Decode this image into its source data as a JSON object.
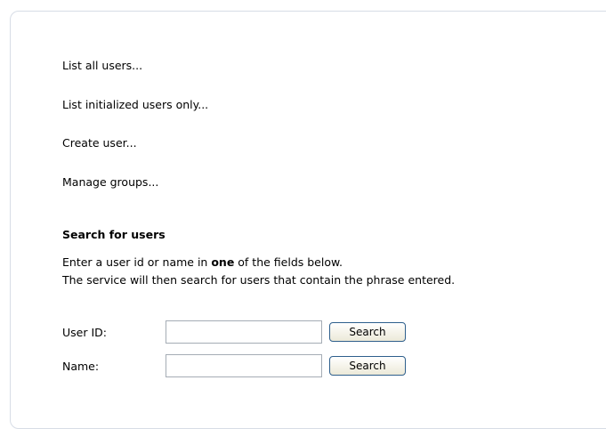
{
  "links": {
    "list_all": "List all users...",
    "list_initialized": "List initialized users only...",
    "create_user": "Create user...",
    "manage_groups": "Manage groups..."
  },
  "search": {
    "heading": "Search for users",
    "desc_prefix": "Enter a user id or name in ",
    "desc_emphasis": "one",
    "desc_suffix": " of the fields below.",
    "desc_line2": "The service will then search for users that contain the phrase entered.",
    "user_id_label": "User ID:",
    "user_id_value": "",
    "name_label": "Name:",
    "name_value": "",
    "search_button_label": "Search"
  },
  "colors": {
    "panel_border": "#d7dde6",
    "button_border": "#2e5f8c",
    "input_border": "#a5acb5"
  }
}
